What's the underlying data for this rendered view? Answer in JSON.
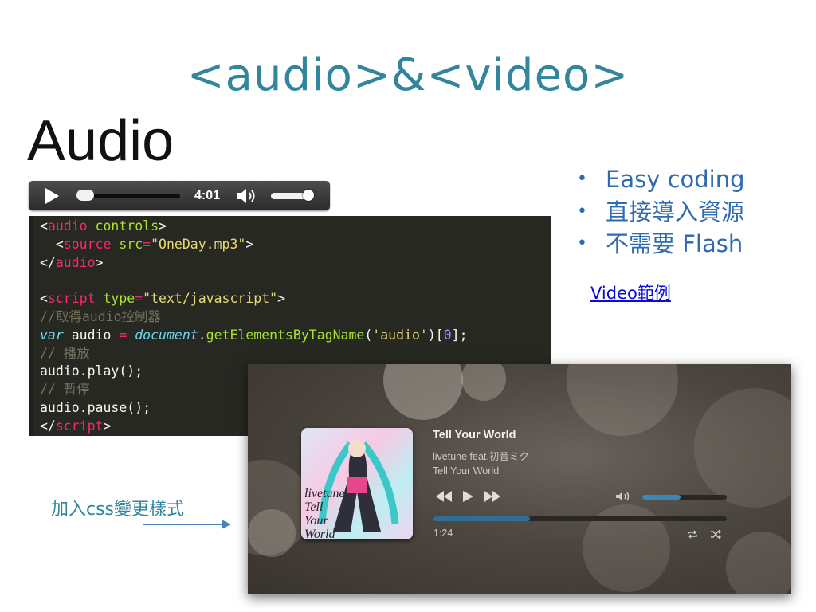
{
  "slide": {
    "title": "<audio>&<video>",
    "section_heading": "Audio"
  },
  "native_audio_player": {
    "time": "4:01",
    "progress_fraction": 0.0,
    "volume_fraction": 0.85
  },
  "code": {
    "line1": [
      "<",
      "audio",
      " ",
      "controls",
      ">"
    ],
    "line2": [
      "  <",
      "source",
      " ",
      "src",
      "=",
      "\"OneDay.mp3\"",
      ">"
    ],
    "line3": [
      "</",
      "audio",
      ">"
    ],
    "line5": [
      "<",
      "script",
      " ",
      "type",
      "=",
      "\"text/javascript\"",
      ">"
    ],
    "line6": "//取得audio控制器",
    "line7": [
      "var",
      " audio ",
      "=",
      " ",
      "document",
      ".",
      "getElementsByTagName",
      "(",
      "'audio'",
      ")[",
      "0",
      "];"
    ],
    "line8": "// 播放",
    "line9": "audio.play();",
    "line10": "// 暫停",
    "line11": "audio.pause();",
    "line12": [
      "</",
      "script",
      ">"
    ]
  },
  "bullets": [
    "Easy coding",
    "直接導入資源",
    "不需要 Flash"
  ],
  "bullet_symbol": "•",
  "video_link": "Video範例",
  "css_caption": "加入css變更樣式",
  "styled_player": {
    "track_title": "Tell Your World",
    "artist": "livetune feat.初音ミク",
    "album": "Tell Your World",
    "elapsed": "1:24",
    "progress_fraction": 0.33,
    "volume_fraction": 0.45,
    "album_art_text": "livetune Tell Your World",
    "accent_color": "#2f6f93"
  },
  "colors": {
    "title": "#31859c",
    "bullets": "#2e6bb0",
    "link": "#0b0bd6",
    "code_bg": "#272822"
  }
}
